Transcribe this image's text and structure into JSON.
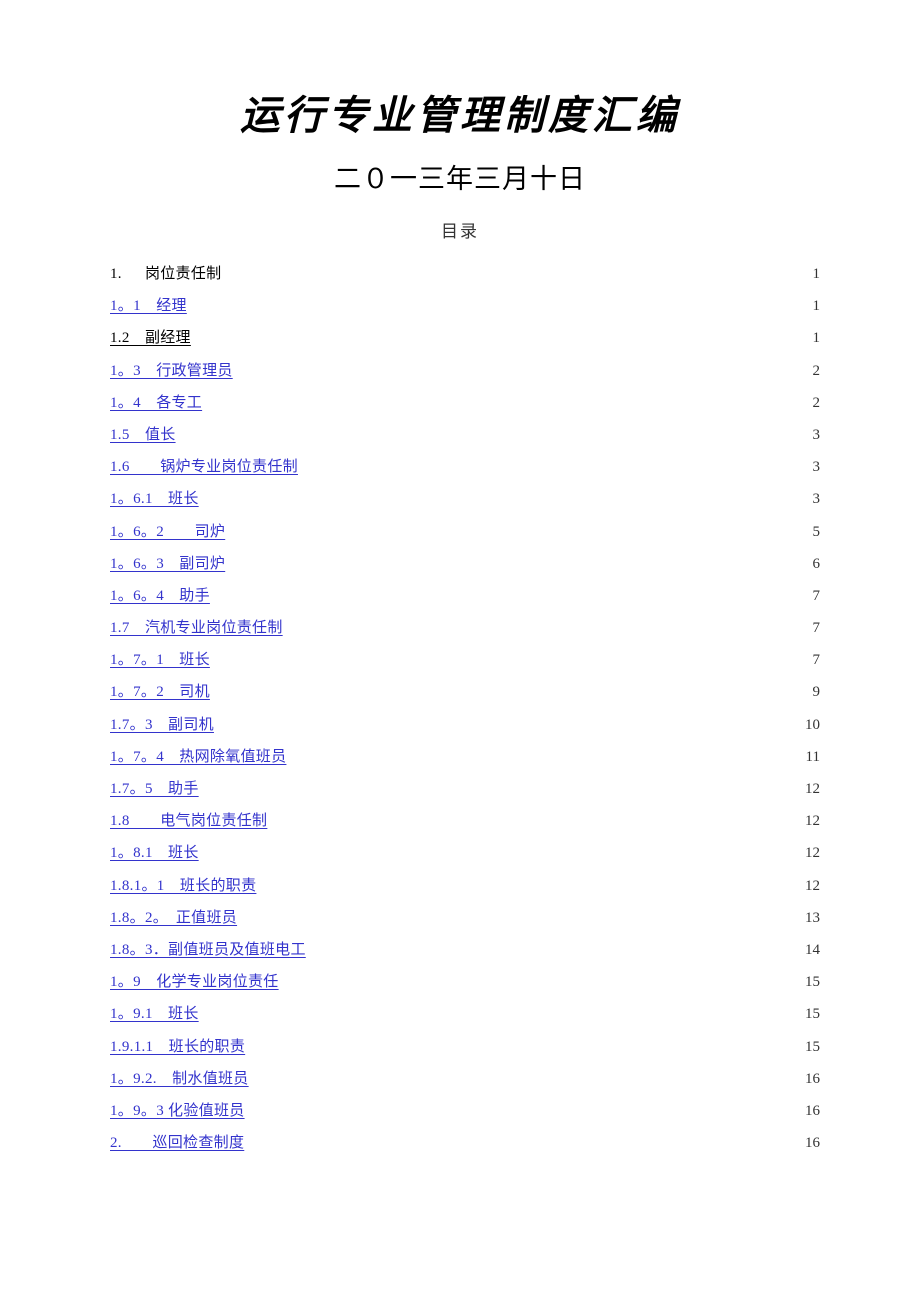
{
  "document": {
    "title": "运行专业管理制度汇编",
    "date": "二０一三年三月十日",
    "toc_heading": "目录"
  },
  "colors": {
    "link": "#3333CC",
    "text": "#000000",
    "leader": "#555555",
    "background": "#FFFFFF"
  },
  "toc": {
    "entries": [
      {
        "label": "1.  岗位责任制",
        "page": "1",
        "style": "plain"
      },
      {
        "label": "1。1　经理",
        "page": "1",
        "style": "link"
      },
      {
        "label": "1.2　副经理",
        "page": "1",
        "style": "plain-underline"
      },
      {
        "label": "1。3　行政管理员",
        "page": "2",
        "style": "link"
      },
      {
        "label": "1。4　各专工",
        "page": "2",
        "style": "link"
      },
      {
        "label": "1.5　值长",
        "page": "3",
        "style": "link"
      },
      {
        "label": "1.6　　锅炉专业岗位责任制",
        "page": "3",
        "style": "link"
      },
      {
        "label": "1。6.1　班长",
        "page": "3",
        "style": "link"
      },
      {
        "label": "1。6。2　　司炉",
        "page": "5",
        "style": "link"
      },
      {
        "label": "1。6。3　副司炉",
        "page": "6",
        "style": "link"
      },
      {
        "label": "1。6。4　助手",
        "page": "7",
        "style": "link"
      },
      {
        "label": "1.7　汽机专业岗位责任制",
        "page": "7",
        "style": "link"
      },
      {
        "label": "1。7。1　班长",
        "page": "7",
        "style": "link"
      },
      {
        "label": "1。7。2　司机",
        "page": "9",
        "style": "link"
      },
      {
        "label": "1.7。3　副司机",
        "page": "10",
        "style": "link"
      },
      {
        "label": "1。7。4　热网除氧值班员",
        "page": "11",
        "style": "link"
      },
      {
        "label": "1.7。5　助手",
        "page": "12",
        "style": "link"
      },
      {
        "label": "1.8　　电气岗位责任制",
        "page": "12",
        "style": "link"
      },
      {
        "label": "1。8.1　班长",
        "page": "12",
        "style": "link"
      },
      {
        "label": "1.8.1。1　班长的职责",
        "page": "12",
        "style": "link"
      },
      {
        "label": "1.8。2。　正值班员",
        "page": "13",
        "style": "link"
      },
      {
        "label": "1.8。3．副值班员及值班电工",
        "page": "14",
        "style": "link"
      },
      {
        "label": "1。9　化学专业岗位责任",
        "page": "15",
        "style": "link"
      },
      {
        "label": "1。9.1　班长",
        "page": "15",
        "style": "link"
      },
      {
        "label": "1.9.1.1　班长的职责",
        "page": "15",
        "style": "link"
      },
      {
        "label": "1。9.2.　制水值班员",
        "page": "16",
        "style": "link"
      },
      {
        "label": "1。9。3 化验值班员",
        "page": "16",
        "style": "link"
      },
      {
        "label": "2.　　巡回检查制度",
        "page": "16",
        "style": "link"
      }
    ]
  }
}
